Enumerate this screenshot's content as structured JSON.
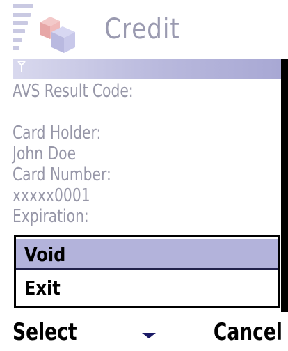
{
  "header": {
    "title": "Credit"
  },
  "details": {
    "avs_label": "AVS Result Code:",
    "holder_label": "Card Holder:",
    "holder_value": "John Doe",
    "number_label": "Card Number:",
    "number_value": "xxxxx0001",
    "expiration_label": "Expiration:"
  },
  "menu": {
    "items": [
      {
        "label": "Void",
        "selected": true
      },
      {
        "label": "Exit",
        "selected": false
      }
    ]
  },
  "softkeys": {
    "left": "Select",
    "right": "Cancel"
  },
  "colors": {
    "accent": "#b3b3db",
    "text_muted": "#9797a8",
    "title": "#9a9ab0"
  }
}
